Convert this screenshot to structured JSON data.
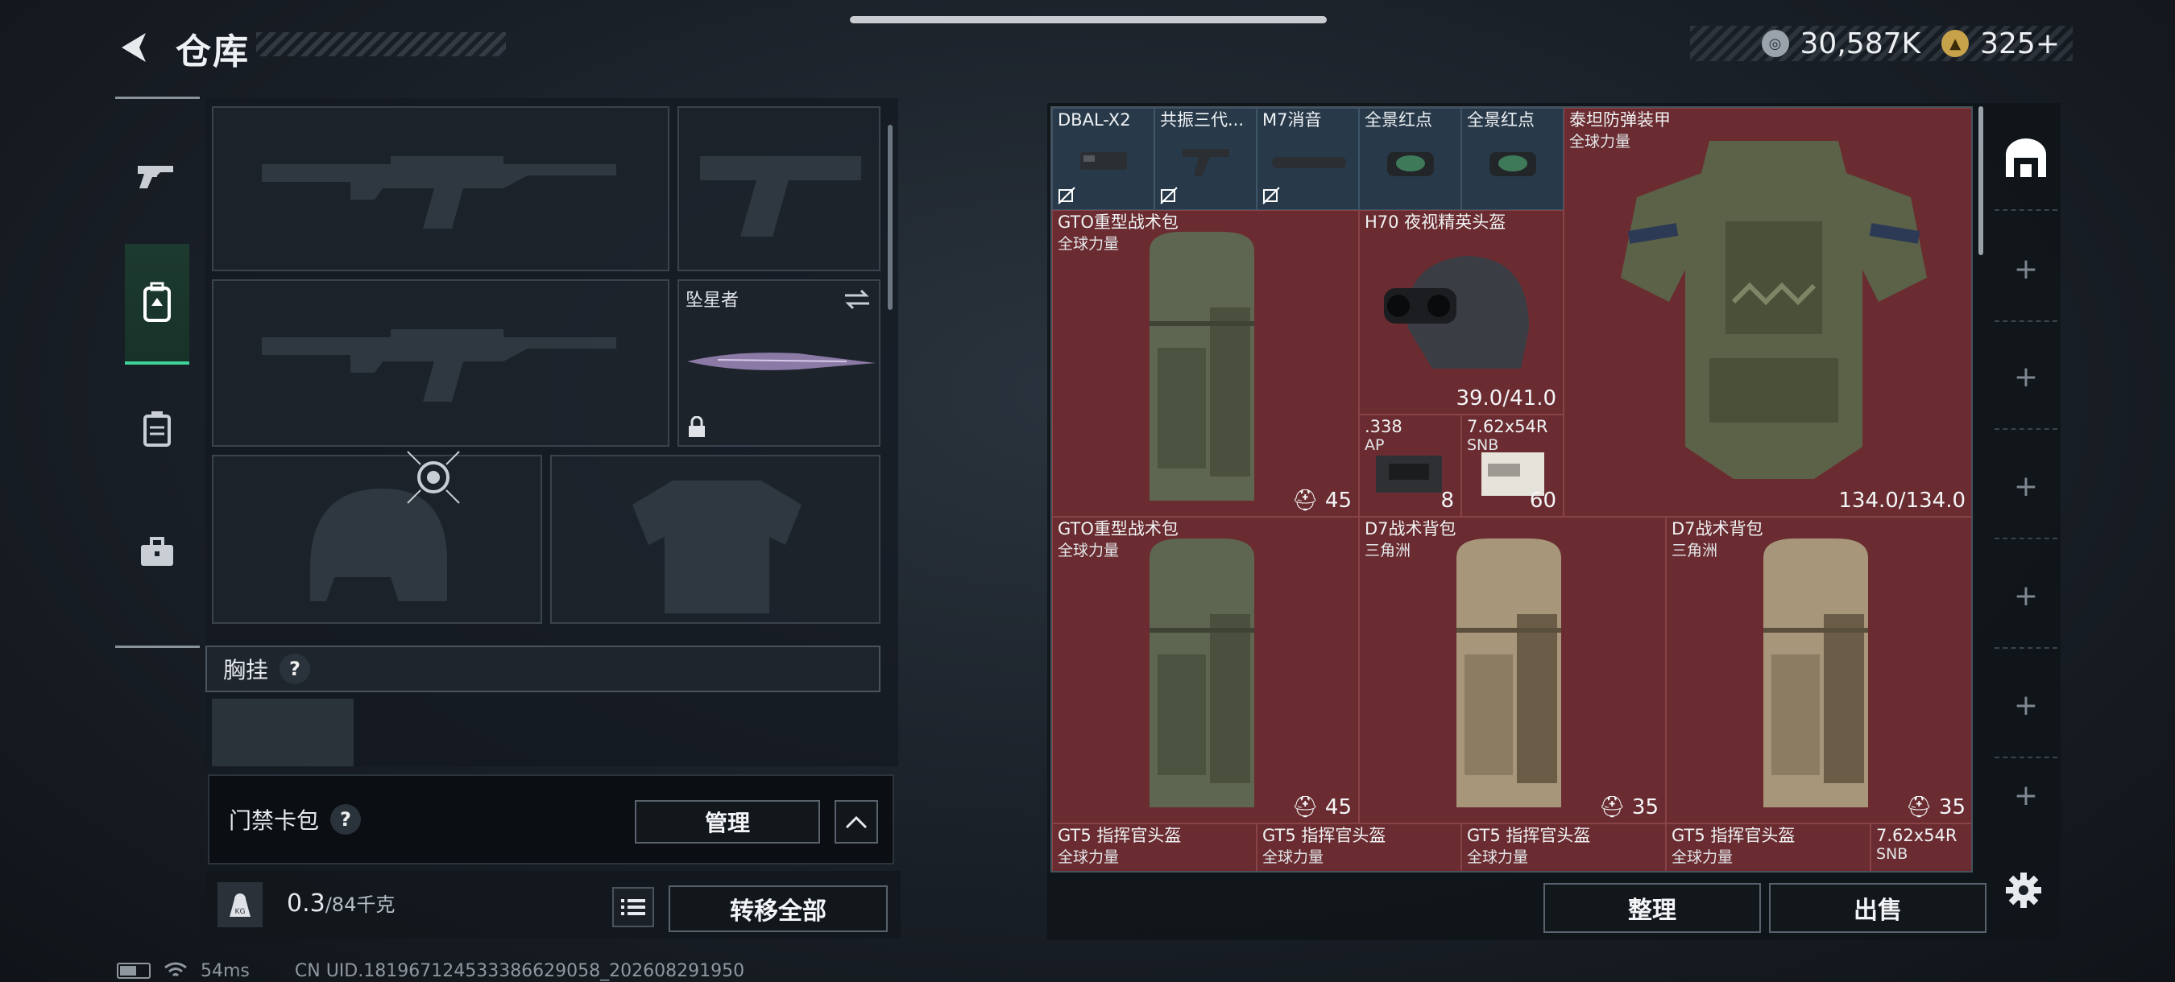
{
  "header": {
    "title": "仓库",
    "currency_silver": "30,587K",
    "currency_gold": "325+"
  },
  "sidebar": {
    "tabs": [
      {
        "icon": "gun-icon"
      },
      {
        "icon": "backpack-icon",
        "active": true
      },
      {
        "icon": "vest-icon"
      },
      {
        "icon": "briefcase-icon"
      }
    ]
  },
  "equipment": {
    "melee_name": "坠星者",
    "chest_rig_label": "胸挂",
    "help_glyph": "?",
    "keycard_label": "门禁卡包",
    "manage_label": "管理",
    "weight_value": "0.3",
    "weight_max": "/84千克",
    "weight_icon_text": "KG",
    "transfer_all_label": "转移全部"
  },
  "status": {
    "ping": "54ms",
    "uid": "CN UID.181967124533386629058_202608291950"
  },
  "stash": {
    "row1": [
      {
        "name": "DBAL-X2"
      },
      {
        "name": "共振三代..."
      },
      {
        "name": "M7消音"
      },
      {
        "name": "全景红点"
      },
      {
        "name": "全景红点"
      }
    ],
    "armor": {
      "name": "泰坦防弹装甲",
      "sub": "全球力量",
      "durability": "134.0/134.0"
    },
    "bag1": {
      "name": "GTO重型战术包",
      "sub": "全球力量",
      "count": "45"
    },
    "helmet": {
      "name": "H70 夜视精英头盔",
      "durability": "39.0/41.0"
    },
    "ammo1": {
      "name": ".338",
      "sub": "AP",
      "count": "8"
    },
    "ammo2": {
      "name": "7.62x54R",
      "sub": "SNB",
      "count": "60"
    },
    "bag2": {
      "name": "GTO重型战术包",
      "sub": "全球力量",
      "count": "45"
    },
    "bag3": {
      "name": "D7战术背包",
      "sub": "三角洲",
      "count": "35"
    },
    "bag4": {
      "name": "D7战术背包",
      "sub": "三角洲",
      "count": "35"
    },
    "row_bottom": [
      {
        "name": "GT5 指挥官头盔",
        "sub": "全球力量"
      },
      {
        "name": "GT5 指挥官头盔",
        "sub": "全球力量"
      },
      {
        "name": "GT5 指挥官头盔",
        "sub": "全球力量"
      },
      {
        "name": "GT5 指挥官头盔",
        "sub": "全球力量"
      },
      {
        "name": "7.62x54R",
        "sub": "SNB"
      }
    ],
    "sort_label": "整理",
    "sell_label": "出售"
  },
  "colors": {
    "accent_green": "#3fd39a",
    "cell_red": "#6a2c30",
    "cell_blue": "#283a4a"
  }
}
